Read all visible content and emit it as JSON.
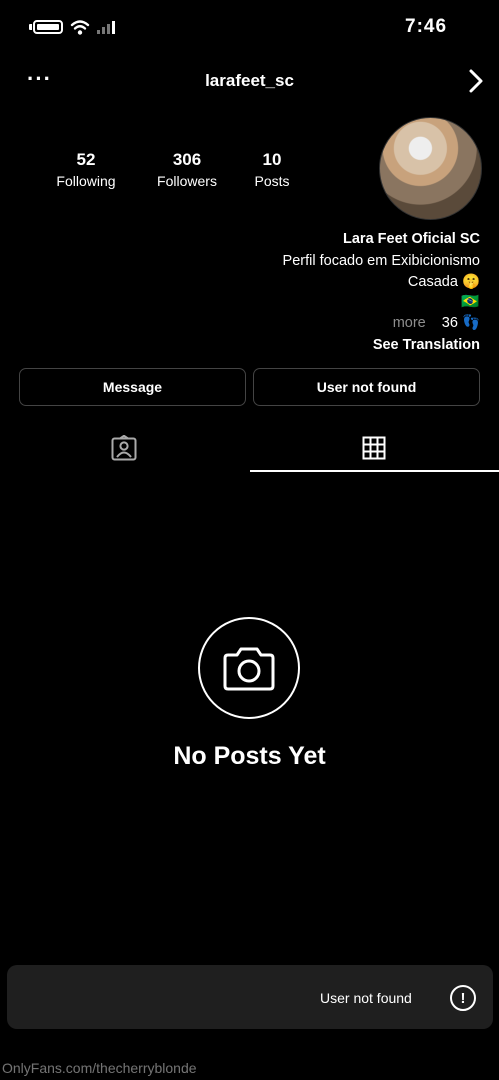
{
  "status_bar": {
    "time": "7:46"
  },
  "header": {
    "username": "larafeet_sc",
    "more_icon": "ellipsis-icon",
    "back_icon": "chevron-icon"
  },
  "profile": {
    "stats": [
      {
        "value": "10",
        "label": "Posts"
      },
      {
        "value": "306",
        "label": "Followers"
      },
      {
        "value": "52",
        "label": "Following"
      }
    ],
    "name": "Lara Feet Oficial SC",
    "bio_line1": "Perfil focado em Exibicionismo",
    "bio_line2": "Casada",
    "bio_emoji": "🤫",
    "flag": "🇧🇷",
    "more_label": "more",
    "count": "36",
    "footprints": "👣",
    "see_translation": "See Translation"
  },
  "actions": {
    "user_not_found": "User not found",
    "message": "Message"
  },
  "empty_state": {
    "title": "No Posts Yet"
  },
  "toast": {
    "text": "User not found",
    "icon": "!"
  },
  "watermark": "OnlyFans.com/thecherryblonde",
  "colors": {
    "background": "#000000",
    "toast_bg": "#1f1f1f",
    "muted": "#8e8e8e"
  }
}
